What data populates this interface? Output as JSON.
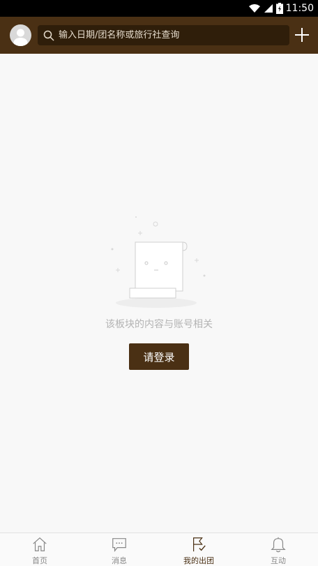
{
  "status_bar": {
    "time": "11:50",
    "icons": [
      "wifi-icon",
      "signal-icon",
      "battery-icon"
    ]
  },
  "header": {
    "avatar_icon": "person-icon",
    "search": {
      "placeholder": "输入日期/团名称或旅行社查询",
      "value": "",
      "icon": "search-icon"
    },
    "add_icon": "plus-icon"
  },
  "empty_state": {
    "illustration": "empty-document-icon",
    "message": "该板块的内容与账号相关",
    "login_label": "请登录"
  },
  "tabbar": {
    "tabs": [
      {
        "label": "首页",
        "icon": "home-icon",
        "active": false
      },
      {
        "label": "消息",
        "icon": "chat-icon",
        "active": false
      },
      {
        "label": "我的出团",
        "icon": "flag-icon",
        "active": true
      },
      {
        "label": "互动",
        "icon": "bell-icon",
        "active": false
      }
    ]
  },
  "colors": {
    "brand": "#4a3014",
    "search_bg": "#2f1e0a",
    "page_bg": "#f8f8f8",
    "muted_text": "#b3b3b3"
  }
}
